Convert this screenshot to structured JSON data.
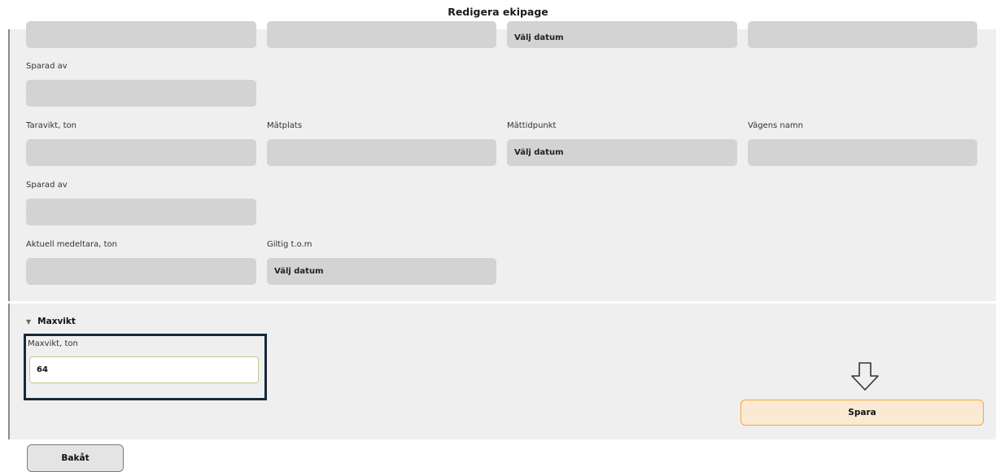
{
  "header": {
    "title": "Redigera ekipage"
  },
  "row0": {
    "date_placeholder": "Välj datum"
  },
  "row1": {
    "sparad_av_label": "Sparad av"
  },
  "row2": {
    "taravikt_label": "Taravikt, ton",
    "matplats_label": "Mätplats",
    "mattidpunkt_label": "Mättidpunkt",
    "mattidpunkt_placeholder": "Välj datum",
    "vagens_namn_label": "Vägens namn"
  },
  "row3": {
    "sparad_av_label": "Sparad av"
  },
  "row4": {
    "medeltara_label": "Aktuell medeltara, ton",
    "giltig_label": "Giltig t.o.m",
    "giltig_placeholder": "Välj datum"
  },
  "maxvikt": {
    "section_title": "Maxvikt",
    "field_label": "Maxvikt, ton",
    "value": "64"
  },
  "actions": {
    "save_label": "Spara",
    "back_label": "Bakåt"
  }
}
